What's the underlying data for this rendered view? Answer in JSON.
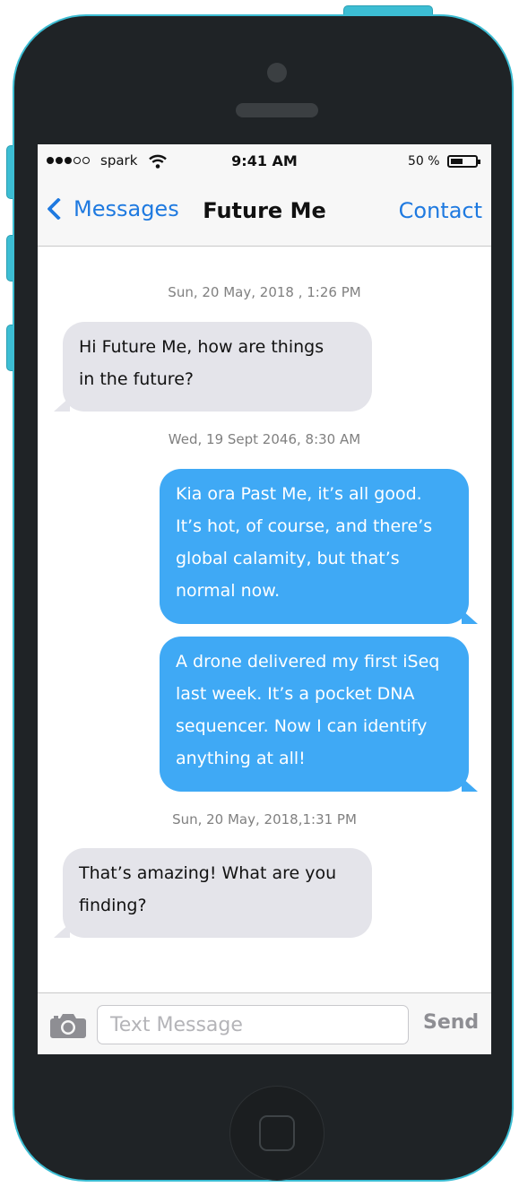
{
  "status_bar": {
    "carrier": "spark",
    "time": "9:41 AM",
    "battery_percent": "50 %",
    "battery_level": 0.5,
    "signal_bars_filled": 3,
    "signal_bars_total": 5
  },
  "nav": {
    "back_label": "Messages",
    "title": "Future Me",
    "action_label": "Contact"
  },
  "messages": [
    {
      "type": "timestamp",
      "text": "Sun, 20 May, 2018 , 1:26 PM"
    },
    {
      "type": "incoming",
      "lines": [
        "Hi Future Me, how are things",
        "in the future?"
      ]
    },
    {
      "type": "timestamp",
      "text": "Wed, 19 Sept 2046, 8:30 AM"
    },
    {
      "type": "outgoing",
      "lines": [
        "Kia ora Past Me, it’s all good.",
        "It’s hot, of course, and there’s",
        "global calamity, but that’s",
        "normal now."
      ]
    },
    {
      "type": "outgoing",
      "lines": [
        "A drone delivered my first iSeq",
        "last week. It’s a pocket DNA",
        "sequencer. Now I can identify",
        "anything at all!"
      ]
    },
    {
      "type": "timestamp",
      "text": "Sun, 20 May, 2018,1:31 PM"
    },
    {
      "type": "incoming",
      "lines": [
        "That’s amazing! What are you",
        "finding?"
      ]
    }
  ],
  "input": {
    "placeholder": "Text Message",
    "send_label": "Send"
  },
  "colors": {
    "accent": "#1f7ae0",
    "outgoing_bubble": "#3fa9f5",
    "incoming_bubble": "#e4e4ea",
    "phone_frame": "#3cbdd3"
  },
  "icons": [
    "chevron-left-icon",
    "wifi-icon",
    "battery-icon",
    "camera-icon"
  ]
}
